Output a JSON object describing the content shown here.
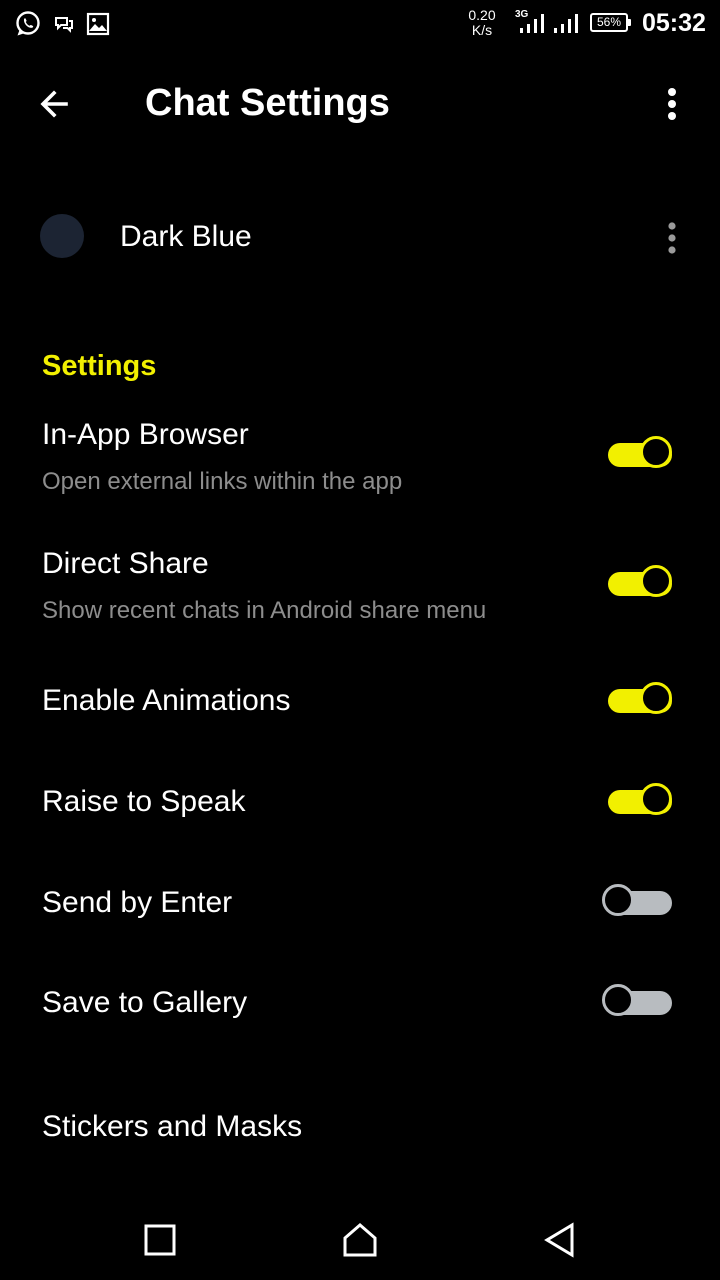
{
  "status_bar": {
    "net_speed_value": "0.20",
    "net_speed_unit": "K/s",
    "network_type": "3G",
    "battery": "56%",
    "time": "05:32"
  },
  "toolbar": {
    "title": "Chat Settings"
  },
  "theme": {
    "name": "Dark Blue",
    "swatch_color": "#1c2433"
  },
  "section": {
    "title": "Settings"
  },
  "settings": [
    {
      "title": "In-App Browser",
      "subtitle": "Open external links within the app",
      "enabled": true
    },
    {
      "title": "Direct Share",
      "subtitle": "Show recent chats in Android share menu",
      "enabled": true
    },
    {
      "title": "Enable Animations",
      "enabled": true
    },
    {
      "title": "Raise to Speak",
      "enabled": true
    },
    {
      "title": "Send by Enter",
      "enabled": false
    },
    {
      "title": "Save to Gallery",
      "enabled": false
    }
  ],
  "link": {
    "label": "Stickers and Masks"
  },
  "colors": {
    "accent": "#f2f000",
    "background": "#000000",
    "subtitle": "#8d8d8d",
    "switch_off": "#b8bcc0"
  }
}
